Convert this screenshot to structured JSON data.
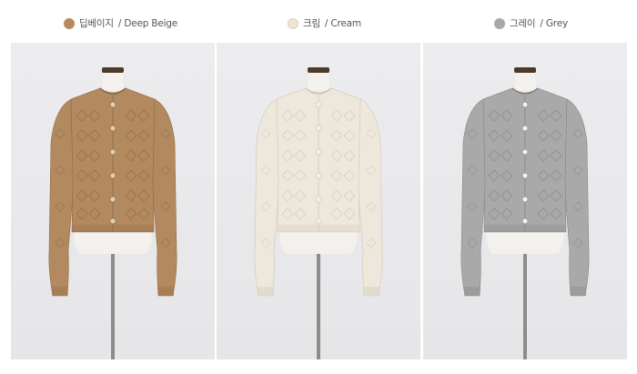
{
  "products": [
    {
      "label_ko": "딥베이지",
      "label_en": " / Deep Beige",
      "swatch": "#b68a5e",
      "knit": "#b38a5f",
      "knit_dark": "#8e6944",
      "knit_light": "#c49d74",
      "button": "#e2cfb4"
    },
    {
      "label_ko": "크림",
      "label_en": " / Cream",
      "swatch": "#ede4d4",
      "knit": "#eee8dc",
      "knit_dark": "#cfc6b5",
      "knit_light": "#f7f3eb",
      "button": "#f4efe6"
    },
    {
      "label_ko": "그레이",
      "label_en": "/ Grey",
      "swatch": "#a8a8a8",
      "knit": "#a9a9a9",
      "knit_dark": "#858585",
      "knit_light": "#bdbdbd",
      "button": "#f0f0f0"
    }
  ],
  "icons": {
    "swatch": "color-dot-icon",
    "mannequin": "mannequin-icon"
  }
}
